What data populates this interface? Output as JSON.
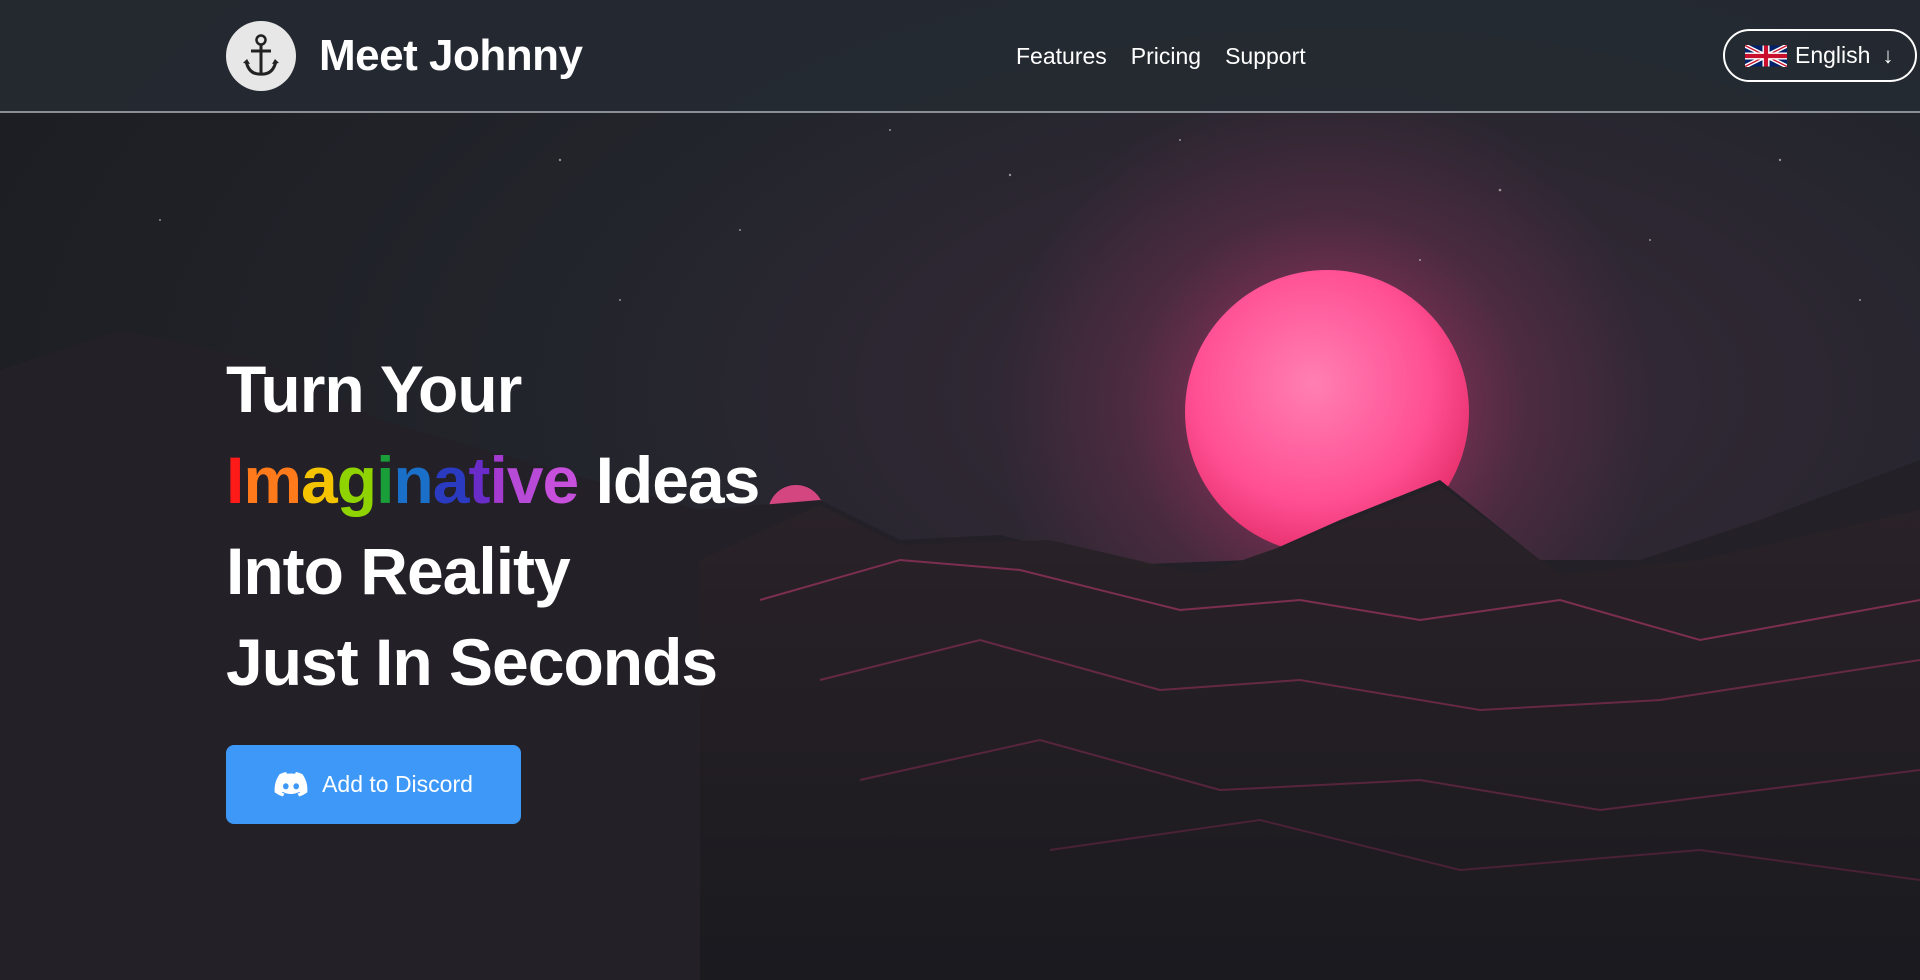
{
  "header": {
    "brand": "Meet Johnny",
    "logo_icon": "anchor-icon",
    "nav": [
      {
        "label": "Features"
      },
      {
        "label": "Pricing"
      },
      {
        "label": "Support"
      }
    ],
    "language": {
      "label": "English",
      "flag_icon": "uk-flag-icon",
      "arrow": "↓"
    }
  },
  "hero": {
    "line1": "Turn Your",
    "line2_rainbow": "Imaginative",
    "line2_rest": " Ideas",
    "line3": "Into Reality",
    "line4": "Just In Seconds",
    "cta": {
      "label": "Add to Discord",
      "icon": "discord-icon",
      "color": "#3d98f8"
    }
  },
  "colors": {
    "rainbow": [
      "#ff1a1a",
      "#ff7a1a",
      "#f5c400",
      "#8fd400",
      "#1a9e3a",
      "#1a6fc9",
      "#2a3bc2",
      "#6a2cc9",
      "#a53ad1",
      "#b84ad8",
      "#c64fdb"
    ],
    "moon": "#ff4f93",
    "header_bg": "#252a32"
  }
}
